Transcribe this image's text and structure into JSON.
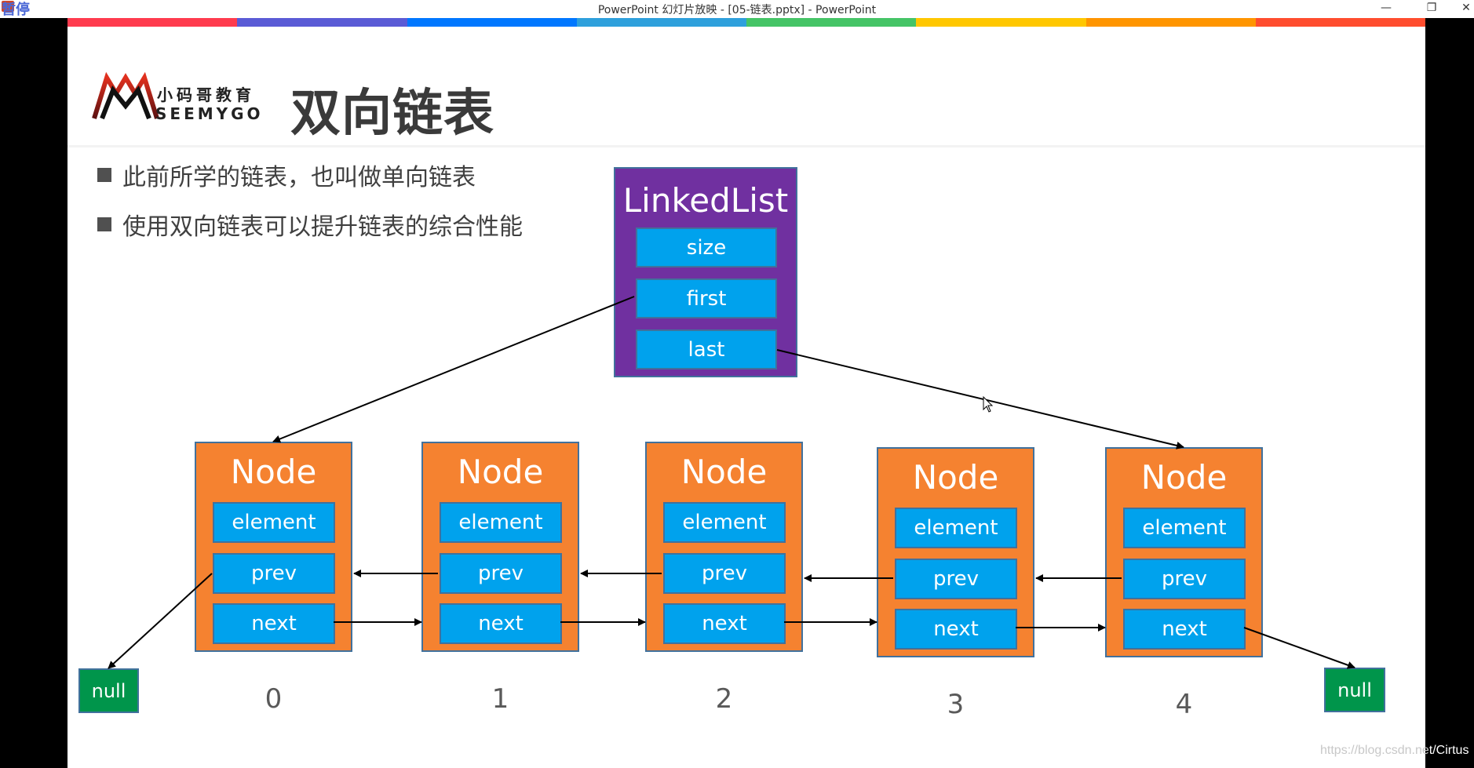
{
  "window": {
    "title": "PowerPoint 幻灯片放映 - [05-链表.pptx] - PowerPoint",
    "overlay_label": "暂停",
    "controls": {
      "minimize": "—",
      "restore": "❐",
      "close": "✕"
    }
  },
  "slide": {
    "color_bar": [
      "#ff3b4e",
      "#5a5bd6",
      "#0077ff",
      "#2ea0dc",
      "#45c466",
      "#ffc700",
      "#ff9500",
      "#ff4d2e"
    ],
    "logo": {
      "cn": "小码哥教育",
      "en": "SEEMYGO"
    },
    "title": "双向链表",
    "bullets": [
      "此前所学的链表，也叫做单向链表",
      "使用双向链表可以提升链表的综合性能"
    ],
    "colors": {
      "linkedlist_fill": "#7030a0",
      "node_fill": "#f58230",
      "field_fill": "#00a2ed",
      "null_fill": "#00954b",
      "border": "#41719c"
    },
    "linked_list": {
      "title": "LinkedList",
      "fields": [
        "size",
        "first",
        "last"
      ]
    },
    "nodes": [
      {
        "title": "Node",
        "fields": [
          "element",
          "prev",
          "next"
        ],
        "index": "0"
      },
      {
        "title": "Node",
        "fields": [
          "element",
          "prev",
          "next"
        ],
        "index": "1"
      },
      {
        "title": "Node",
        "fields": [
          "element",
          "prev",
          "next"
        ],
        "index": "2"
      },
      {
        "title": "Node",
        "fields": [
          "element",
          "prev",
          "next"
        ],
        "index": "3"
      },
      {
        "title": "Node",
        "fields": [
          "element",
          "prev",
          "next"
        ],
        "index": "4"
      }
    ],
    "null_left": "null",
    "null_right": "null",
    "links": [
      {
        "from": "LinkedList.first",
        "to": "Node 0"
      },
      {
        "from": "LinkedList.last",
        "to": "Node 4"
      },
      {
        "from": "Node 0.prev",
        "to": "null (left)"
      },
      {
        "from": "Node 0.next",
        "to": "Node 1"
      },
      {
        "from": "Node 1.prev",
        "to": "Node 0"
      },
      {
        "from": "Node 1.next",
        "to": "Node 2"
      },
      {
        "from": "Node 2.prev",
        "to": "Node 1"
      },
      {
        "from": "Node 2.next",
        "to": "Node 3"
      },
      {
        "from": "Node 3.prev",
        "to": "Node 2"
      },
      {
        "from": "Node 3.next",
        "to": "Node 4"
      },
      {
        "from": "Node 4.prev",
        "to": "Node 3"
      },
      {
        "from": "Node 4.next",
        "to": "null (right)"
      }
    ]
  },
  "watermark": {
    "light": "https://blog.csdn.ne",
    "dark": "t/Cirtus"
  }
}
